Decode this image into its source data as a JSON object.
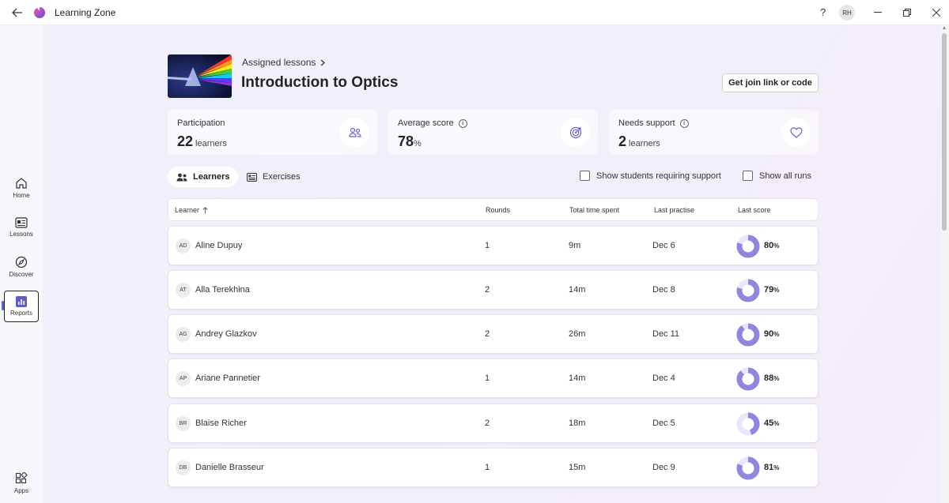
{
  "window": {
    "title": "Learning Zone",
    "help_label": "?",
    "user_initials": "RH"
  },
  "sidebar": {
    "items": [
      {
        "label": "Home",
        "icon": "home-icon"
      },
      {
        "label": "Lessons",
        "icon": "lessons-icon"
      },
      {
        "label": "Discover",
        "icon": "discover-icon"
      },
      {
        "label": "Reports",
        "icon": "reports-icon",
        "active": true
      },
      {
        "label": "Apps",
        "icon": "apps-icon"
      }
    ]
  },
  "header": {
    "breadcrumb": "Assigned lessons",
    "title": "Introduction to Optics",
    "join_button": "Get join link or code"
  },
  "stats": [
    {
      "label": "Participation",
      "value": "22",
      "unit": "learners",
      "icon": "people-icon",
      "info": false
    },
    {
      "label": "Average score",
      "value": "78",
      "unit": "%",
      "icon": "target-icon",
      "info": true
    },
    {
      "label": "Needs support",
      "value": "2",
      "unit": "learners",
      "icon": "heart-icon",
      "info": true
    }
  ],
  "tabs": [
    {
      "label": "Learners",
      "icon": "learners-icon",
      "selected": true
    },
    {
      "label": "Exercises",
      "icon": "exercises-icon",
      "selected": false
    }
  ],
  "filters": [
    {
      "label": "Show students requiring support",
      "checked": false
    },
    {
      "label": "Show all runs",
      "checked": false
    }
  ],
  "table": {
    "columns": [
      "Learner",
      "Rounds",
      "Total time spent",
      "Last practise",
      "Last score"
    ],
    "rows": [
      {
        "initials": "AD",
        "name": "Aline Dupuy",
        "rounds": "1",
        "time": "9m",
        "last": "Dec 6",
        "score": 80
      },
      {
        "initials": "AT",
        "name": "Alla Terekhina",
        "rounds": "2",
        "time": "14m",
        "last": "Dec 8",
        "score": 79
      },
      {
        "initials": "AG",
        "name": "Andrey Glazkov",
        "rounds": "2",
        "time": "26m",
        "last": "Dec 11",
        "score": 90
      },
      {
        "initials": "AP",
        "name": "Ariane Pannetier",
        "rounds": "1",
        "time": "14m",
        "last": "Dec 4",
        "score": 88
      },
      {
        "initials": "BR",
        "name": "Blaise Richer",
        "rounds": "2",
        "time": "18m",
        "last": "Dec 5",
        "score": 45
      },
      {
        "initials": "DB",
        "name": "Danielle Brasseur",
        "rounds": "1",
        "time": "15m",
        "last": "Dec 9",
        "score": 81
      }
    ],
    "score_unit": "%"
  },
  "colors": {
    "accent": "#5b5fc7",
    "donut_fill": "#8f86e0",
    "donut_track": "#e8e6f8"
  }
}
